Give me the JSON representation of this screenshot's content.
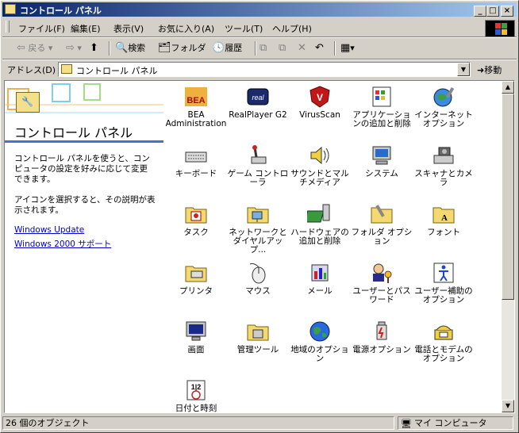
{
  "window": {
    "title": "コントロール パネル"
  },
  "caption_buttons": {
    "minimize": "_",
    "maximize": "□",
    "close": "×"
  },
  "menu": [
    "ファイル(F)",
    "編集(E)",
    "表示(V)",
    "お気に入り(A)",
    "ツール(T)",
    "ヘルプ(H)"
  ],
  "toolbar": {
    "back": "戻る",
    "search": "検索",
    "folders": "フォルダ",
    "history": "履歴"
  },
  "address": {
    "label": "アドレス(D)",
    "value": "コントロール パネル",
    "go": "移動"
  },
  "left_pane": {
    "title": "コントロール パネル",
    "description": "コントロール パネルを使うと、コンピュータの設定を好みに応じて変更できます。",
    "hint": "アイコンを選択すると、その説明が表示されます。",
    "links": [
      "Windows Update",
      "Windows 2000 サポート"
    ]
  },
  "icons": [
    {
      "label": "BEA Administration",
      "icon": "bea-icon"
    },
    {
      "label": "RealPlayer G2",
      "icon": "realplayer-icon"
    },
    {
      "label": "VirusScan",
      "icon": "virusscan-icon"
    },
    {
      "label": "アプリケーションの追加と削除",
      "icon": "add-remove-programs-icon"
    },
    {
      "label": "インターネット オプション",
      "icon": "internet-options-icon"
    },
    {
      "label": "キーボード",
      "icon": "keyboard-icon"
    },
    {
      "label": "ゲーム コントローラ",
      "icon": "game-controller-icon"
    },
    {
      "label": "サウンドとマルチメディア",
      "icon": "sound-icon"
    },
    {
      "label": "システム",
      "icon": "system-icon"
    },
    {
      "label": "スキャナとカメラ",
      "icon": "scanner-camera-icon"
    },
    {
      "label": "タスク",
      "icon": "scheduled-tasks-icon"
    },
    {
      "label": "ネットワークとダイヤルアップ...",
      "icon": "network-icon"
    },
    {
      "label": "ハードウェアの追加と削除",
      "icon": "add-hardware-icon"
    },
    {
      "label": "フォルダ オプション",
      "icon": "folder-options-icon"
    },
    {
      "label": "フォント",
      "icon": "fonts-icon"
    },
    {
      "label": "プリンタ",
      "icon": "printers-icon"
    },
    {
      "label": "マウス",
      "icon": "mouse-icon"
    },
    {
      "label": "メール",
      "icon": "mail-icon"
    },
    {
      "label": "ユーザーとパスワード",
      "icon": "users-passwords-icon"
    },
    {
      "label": "ユーザー補助のオプション",
      "icon": "accessibility-icon"
    },
    {
      "label": "画面",
      "icon": "display-icon"
    },
    {
      "label": "管理ツール",
      "icon": "admin-tools-icon"
    },
    {
      "label": "地域のオプション",
      "icon": "regional-options-icon"
    },
    {
      "label": "電源オプション",
      "icon": "power-options-icon"
    },
    {
      "label": "電話とモデムのオプション",
      "icon": "phone-modem-icon"
    },
    {
      "label": "日付と時刻",
      "icon": "date-time-icon"
    }
  ],
  "status": {
    "count": "26 個のオブジェクト",
    "zone": "マイ コンピュータ"
  },
  "colors": {
    "titlebar_start": "#0a246a",
    "titlebar_end": "#a6caf0",
    "face": "#d4d0c8",
    "link": "#0000cc"
  }
}
